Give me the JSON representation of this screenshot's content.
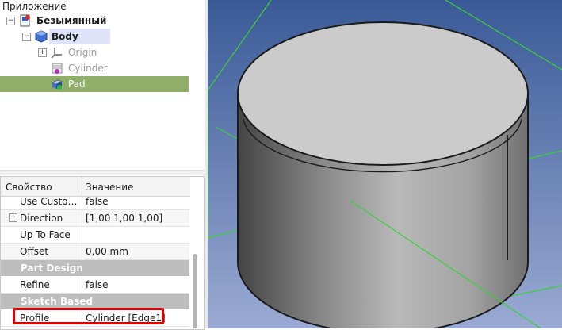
{
  "tree": {
    "title": "Приложение",
    "items": [
      {
        "label": "Безымянный",
        "expander": "−"
      },
      {
        "label": "Body",
        "expander": "−"
      },
      {
        "label": "Origin",
        "expander": "+"
      },
      {
        "label": "Cylinder"
      },
      {
        "label": "Pad"
      }
    ]
  },
  "properties": {
    "headers": {
      "name": "Свойство",
      "value": "Значение"
    },
    "rows": [
      {
        "name": "Use Custo…",
        "value": "false"
      },
      {
        "name": "Direction",
        "value": "[1,00 1,00 1,00]"
      },
      {
        "name": "Up To Face",
        "value": ""
      },
      {
        "name": "Offset",
        "value": "0,00 mm"
      },
      {
        "group": "Part Design"
      },
      {
        "name": "Refine",
        "value": "false"
      },
      {
        "group": "Sketch Based"
      },
      {
        "name": "Profile",
        "value": "Cylinder [Edge1]"
      }
    ]
  },
  "colors": {
    "selected_row": "#8fae67",
    "body_row": "#dfe3f7",
    "highlight_box": "#e00000",
    "bbox_lines": "#38d138"
  }
}
